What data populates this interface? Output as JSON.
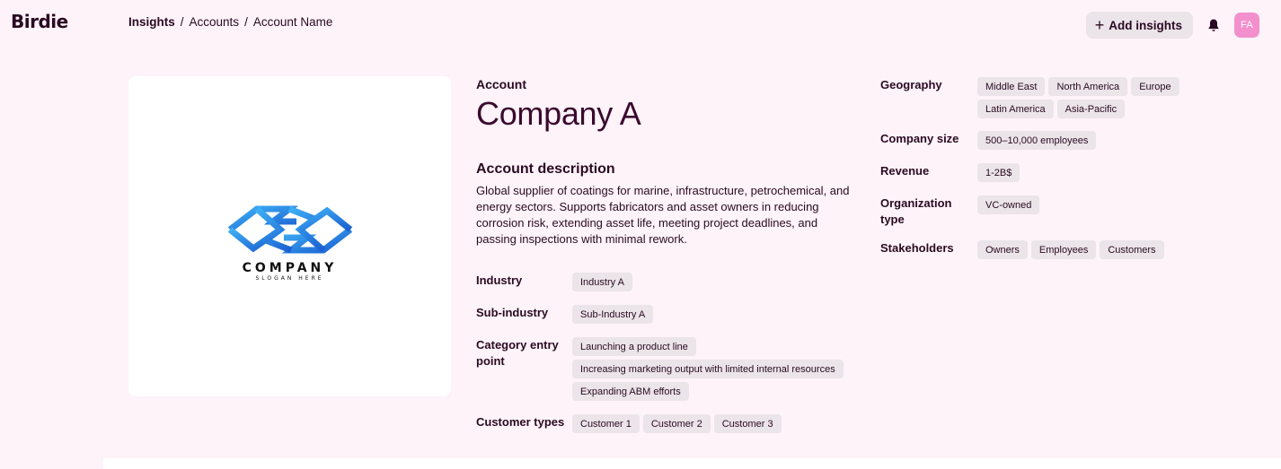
{
  "app": {
    "brand": "Birdie"
  },
  "breadcrumb": [
    "Insights",
    "Accounts",
    "Account Name"
  ],
  "header": {
    "add_insights_label": "Add insights",
    "avatar_initials": "FA"
  },
  "company_logo": {
    "wordmark": "COMPANY",
    "slogan": "SLOGAN HERE"
  },
  "account": {
    "label": "Account",
    "name": "Company A",
    "description_heading": "Account description",
    "description": "Global supplier of coatings for marine, infrastructure, petrochemical, and energy sectors. Supports fabricators and asset owners in reducing corrosion risk, extending asset life, meeting project deadlines, and passing inspections with minimal rework."
  },
  "details_left": {
    "industry": {
      "label": "Industry",
      "tags": [
        "Industry A"
      ]
    },
    "sub_industry": {
      "label": "Sub-industry",
      "tags": [
        "Sub-Industry A"
      ]
    },
    "category_entry_point": {
      "label": "Category entry point",
      "tags": [
        "Launching a product line",
        "Increasing marketing output with limited internal resources",
        "Expanding ABM efforts"
      ]
    },
    "customer_types": {
      "label": "Customer types",
      "tags": [
        "Customer 1",
        "Customer 2",
        "Customer 3"
      ]
    }
  },
  "details_right": {
    "geography": {
      "label": "Geography",
      "tags": [
        "Middle East",
        "North America",
        "Europe",
        "Latin America",
        "Asia-Pacific"
      ]
    },
    "company_size": {
      "label": "Company size",
      "tags": [
        "500–10,000 employees"
      ]
    },
    "revenue": {
      "label": "Revenue",
      "tags": [
        "1-2B$"
      ]
    },
    "organization_type": {
      "label": "Organization type",
      "tags": [
        "VC-owned"
      ]
    },
    "stakeholders": {
      "label": "Stakeholders",
      "tags": [
        "Owners",
        "Employees",
        "Customers"
      ]
    }
  },
  "icons": {
    "add": "plus-icon",
    "notifications": "bell-icon"
  },
  "colors": {
    "background": "#fdf3f8",
    "text": "#2a0a23",
    "tag_bg": "#ebe4e8",
    "avatar": "#f38fcd",
    "logo_blue": "#1f7de0"
  }
}
